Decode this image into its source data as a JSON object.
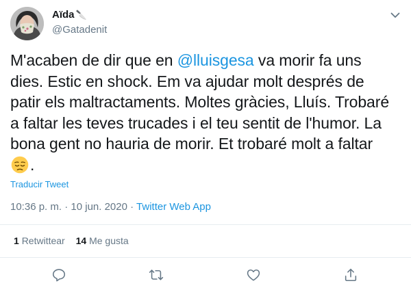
{
  "author": {
    "display_name": "Aïda",
    "name_emoji": "🔪",
    "handle": "@Gatadenit",
    "avatar_icon": "profile-photo"
  },
  "tweet": {
    "text_before": "M'acaben de dir que en ",
    "mention": "@lluisgesa",
    "text_after": " va morir fa uns dies. Estic en shock. Em va ajudar molt després de patir els maltractaments. Moltes gràcies, Lluís. Trobaré a faltar les teves trucades i el teu sentit de l'humor. La bona gent no hauria de morir. Et trobaré molt a faltar",
    "trailing": ".",
    "emoji": "pensive-face"
  },
  "translate_label": "Traducir Tweet",
  "meta": {
    "time": "10:36 p. m.",
    "separator": " · ",
    "date": "10 jun. 2020",
    "source": "Twitter Web App"
  },
  "stats": {
    "retweets_count": "1",
    "retweets_label": "Retwittear",
    "likes_count": "14",
    "likes_label": "Me gusta"
  },
  "actions": {
    "reply_icon": "reply-icon",
    "retweet_icon": "retweet-icon",
    "like_icon": "heart-icon",
    "share_icon": "share-icon"
  },
  "colors": {
    "link": "#1b95e0",
    "secondary": "#657786",
    "text": "#14171a",
    "divider": "#e6ecf0"
  }
}
